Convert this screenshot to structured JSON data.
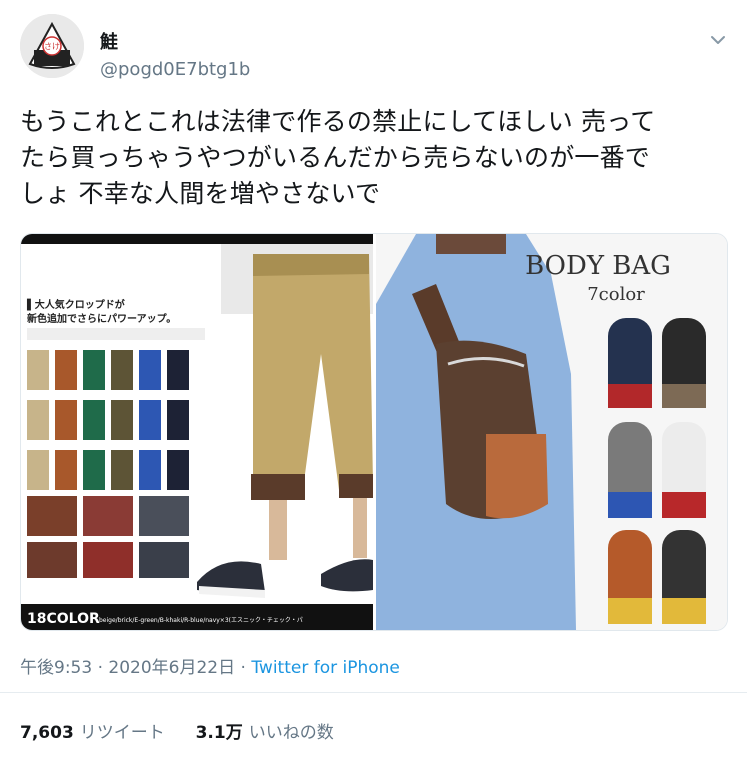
{
  "user": {
    "name": "鮭",
    "handle": "@pogd0E7btg1b"
  },
  "tweet": {
    "text_lines": [
      "もうこれとこれは法律で作るの禁止にしてほしい 売って",
      "たら買っちゃうやつがいるんだから売らないのが一番で",
      "しょ 不幸な人間を増やさないで"
    ]
  },
  "media": {
    "left": {
      "headline_line1": "▌大人気クロップドが",
      "headline_line2": "新色追加でさらにパワーアップ。",
      "footer_main": "18COLOR",
      "footer_sub": "beige/brick/E-green/B-khaki/R-blue/navy×3(エスニック・チェック・パ"
    },
    "right": {
      "title": "BODY BAG",
      "subtitle": "7color"
    }
  },
  "meta": {
    "time": "午後9:53",
    "date": "2020年6月22日",
    "dot": "·",
    "source": "Twitter for iPhone"
  },
  "stats": {
    "retweets_count": "7,603",
    "retweets_label": "リツイート",
    "likes_count": "3.1万",
    "likes_label": "いいねの数"
  },
  "colors": {
    "link": "#1b95e0",
    "secondary": "#657786",
    "primary": "#14171a"
  }
}
